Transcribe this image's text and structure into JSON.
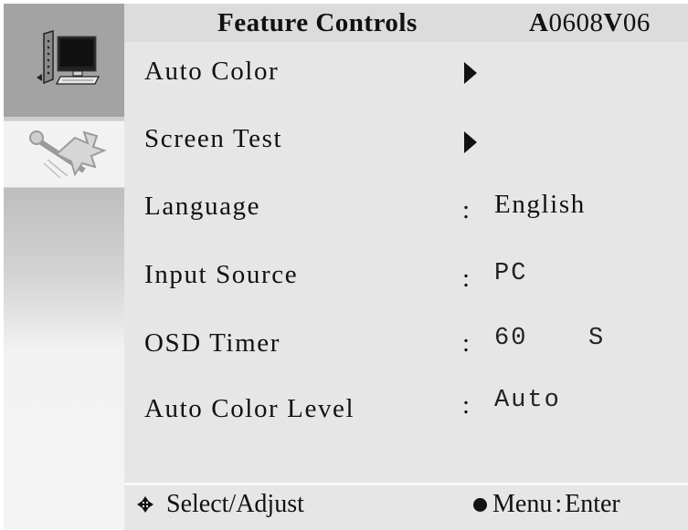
{
  "header": {
    "title": "Feature Controls",
    "model_prefix": "A",
    "model_mid": "0608",
    "model_v": "V",
    "model_suffix": "06"
  },
  "sidebar": {
    "tabs": [
      {
        "icon": "monitor-icon",
        "selected": true
      },
      {
        "icon": "tools-icon",
        "selected": false
      }
    ]
  },
  "menu": {
    "items": [
      {
        "label": "Auto Color",
        "indicator": "arrow-right"
      },
      {
        "label": "Screen Test",
        "indicator": "arrow-right"
      },
      {
        "label": "Language",
        "colon": ":",
        "value": "English"
      },
      {
        "label": "Input Source",
        "colon": ":",
        "value": "PC"
      },
      {
        "label": "OSD Timer",
        "colon": ":",
        "value": "60",
        "unit": "S"
      },
      {
        "label": "Auto Color Level",
        "colon": ":",
        "value": "Auto"
      }
    ]
  },
  "footer": {
    "select_label": "Select/Adjust",
    "menu_key": "Menu",
    "menu_sep": ":",
    "menu_action": "Enter"
  },
  "colors": {
    "panel_bg": "#e6e6e6",
    "header_bg": "#dcdcdc",
    "selected_tab_bg": "#a3a3a3",
    "text": "#111111"
  }
}
